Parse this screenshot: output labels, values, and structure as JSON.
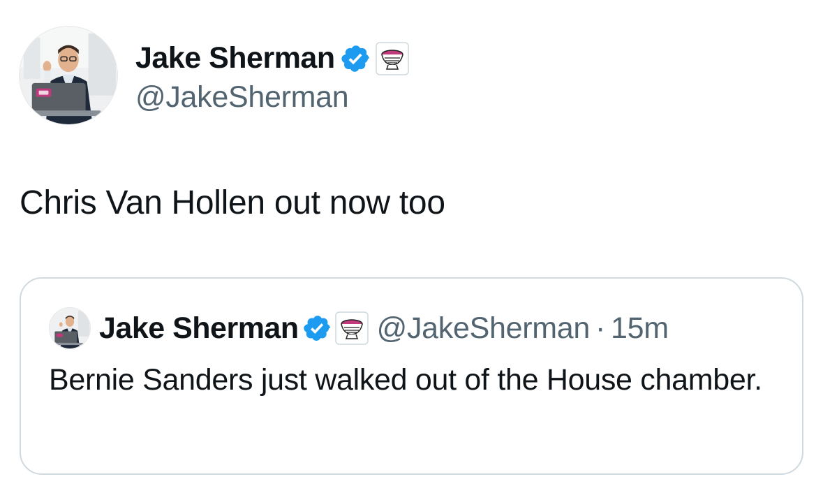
{
  "author": {
    "display_name": "Jake Sherman",
    "handle": "@JakeSherman",
    "verified_color": "#1d9bf0",
    "avatar_icon": "profile-photo-man-with-laptop",
    "affiliation_icon": "punchbowl-logo"
  },
  "tweet": {
    "text": "Chris Van Hollen out now too"
  },
  "quoted_tweet": {
    "display_name": "Jake Sherman",
    "handle": "@JakeSherman",
    "separator": "·",
    "time": "15m",
    "text": "Bernie Sanders just walked out of the House chamber."
  },
  "colors": {
    "text_primary": "#0f1419",
    "text_secondary": "#536471",
    "border": "#cfd9de",
    "verified": "#1d9bf0",
    "affiliation_pink": "#c0397a"
  }
}
